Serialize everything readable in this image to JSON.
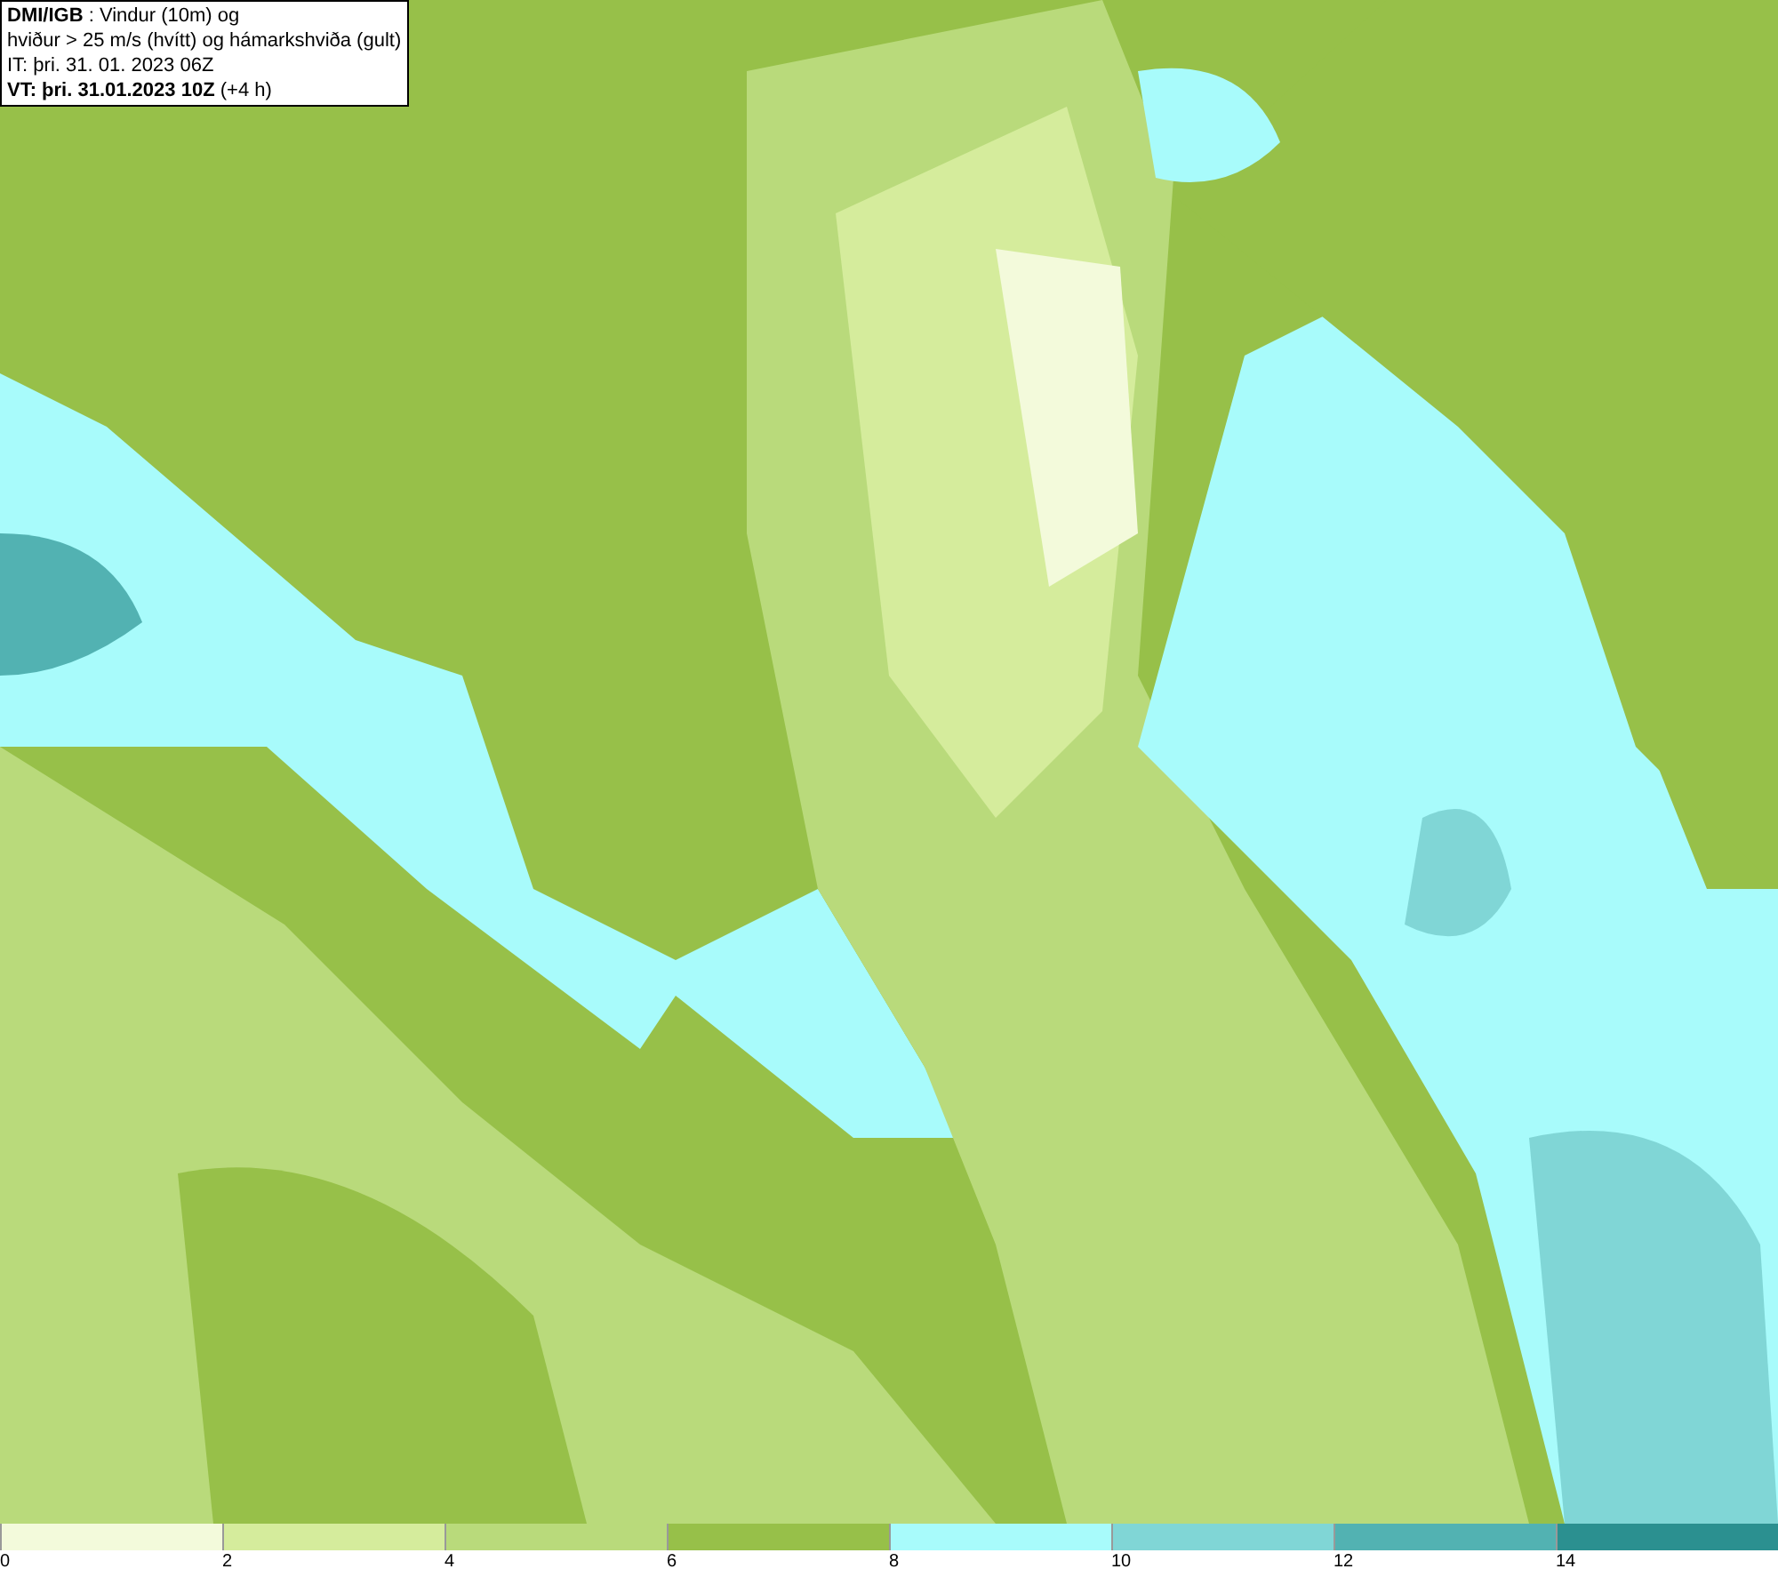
{
  "info_box": {
    "lines": [
      "**DMI/IGB** : Vindur (10m) og",
      "hviður > 25 m/s (hvítt) og hámarkshviða (gult)",
      "IT: þri. 31. 01. 2023 06Z",
      "**VT: þri. 31.01.2023 10Z** (+4 h)"
    ]
  },
  "legend": [
    {
      "label": "0",
      "color": "#f3fadb"
    },
    {
      "label": "2",
      "color": "#d5ec9c"
    },
    {
      "label": "4",
      "color": "#b9da7b"
    },
    {
      "label": "6",
      "color": "#97c049"
    },
    {
      "label": "8",
      "color": "#a8fbfb"
    },
    {
      "label": "10",
      "color": "#80d6d6"
    },
    {
      "label": "12",
      "color": "#52b2b2"
    },
    {
      "label": "14",
      "color": "#2b9090"
    }
  ]
}
